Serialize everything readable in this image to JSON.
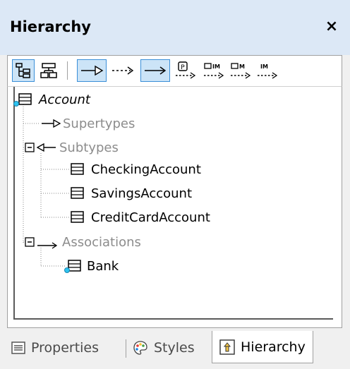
{
  "panel": {
    "title": "Hierarchy",
    "close_glyph": "×"
  },
  "toolbar": {
    "buttons": [
      {
        "icon": "tree-view-icon",
        "active": true
      },
      {
        "icon": "graph-view-icon",
        "active": false
      },
      {
        "icon": "show-generalization-icon",
        "active": true
      },
      {
        "icon": "show-realization-icon",
        "active": false
      },
      {
        "icon": "show-association-icon",
        "active": true
      },
      {
        "icon": "show-package-dependency-icon",
        "active": false
      },
      {
        "icon": "show-import-dependency-icon",
        "active": false
      },
      {
        "icon": "show-merge-dependency-icon",
        "active": false
      },
      {
        "icon": "show-import-icon",
        "active": false
      }
    ],
    "glyph_p": "P",
    "glyph_im": "IM",
    "glyph_m": "M"
  },
  "tree": {
    "root": "Account",
    "supertypes": "Supertypes",
    "subtypes": "Subtypes",
    "subtype_items": [
      "CheckingAccount",
      "SavingsAccount",
      "CreditCardAccount"
    ],
    "associations": "Associations",
    "association_items": [
      "Bank"
    ]
  },
  "tabs": [
    {
      "label": "Properties",
      "icon": "properties-icon",
      "active": false
    },
    {
      "label": "Styles",
      "icon": "palette-icon",
      "active": false
    },
    {
      "label": "Hierarchy",
      "icon": "hierarchy-icon",
      "active": true
    }
  ],
  "colors": {
    "title_bar": "#dce8f6",
    "active_button_fill": "#cce4f7",
    "active_button_border": "#3a8fd8",
    "gray_label": "#8c8c8c",
    "anchor_dot": "#2ec4f0"
  }
}
